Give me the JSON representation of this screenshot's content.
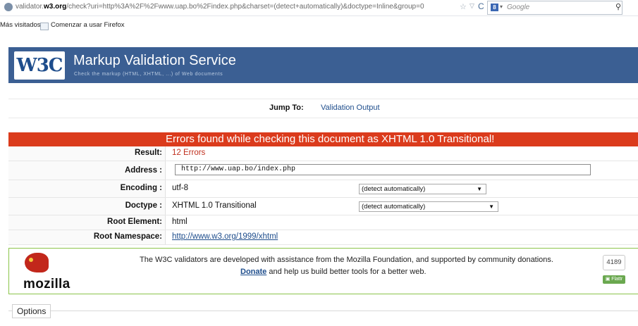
{
  "browser": {
    "url_prefix": "validator.",
    "url_domain": "w3.org",
    "url_rest": "/check?uri=http%3A%2F%2Fwww.uap.bo%2Findex.php&charset=(detect+automatically)&doctype=Inline&group=0",
    "search_placeholder": "Google",
    "bookmarks": [
      "Más visitados",
      "Comenzar a usar Firefox"
    ]
  },
  "banner": {
    "logo_text": "W3C",
    "title": "Markup Validation Service",
    "subtitle": "Check the markup (HTML, XHTML, ...) of Web documents"
  },
  "jump": {
    "label": "Jump To:",
    "link": "Validation Output"
  },
  "results": {
    "banner": "Errors found while checking this document as XHTML 1.0 Transitional!",
    "rows": {
      "result": {
        "label": "Result:",
        "value": "12 Errors"
      },
      "address": {
        "label": "Address :",
        "value": "http://www.uap.bo/index.php"
      },
      "encoding": {
        "label": "Encoding :",
        "value": "utf-8",
        "select": "(detect automatically)"
      },
      "doctype": {
        "label": "Doctype :",
        "value": "XHTML 1.0 Transitional",
        "select": "(detect automatically)"
      },
      "root_element": {
        "label": "Root Element:",
        "value": "html"
      },
      "root_namespace": {
        "label": "Root Namespace:",
        "value": "http://www.w3.org/1999/xhtml"
      }
    }
  },
  "donation": {
    "logo_word": "mozilla",
    "text1": "The W3C validators are developed with assistance from the Mozilla Foundation, and supported by community donations.",
    "donate_link": "Donate",
    "text2": "and help us build better tools for a better web.",
    "count": "4189",
    "flattr": "Flattr"
  },
  "options": {
    "label": "Options"
  }
}
